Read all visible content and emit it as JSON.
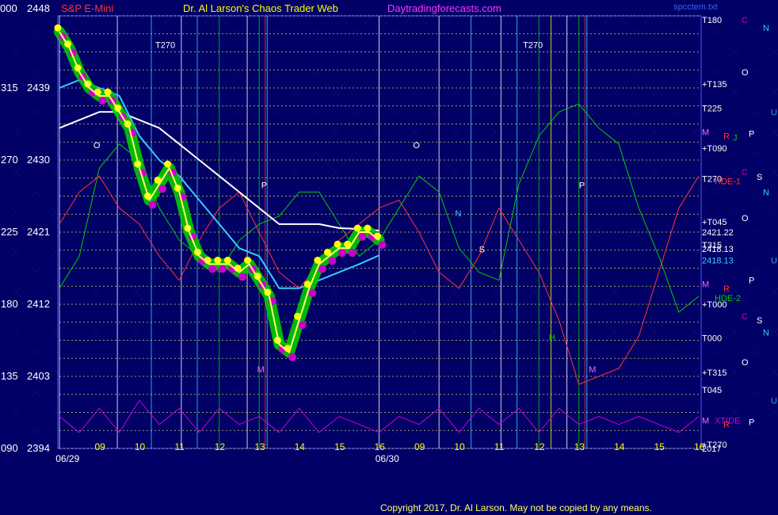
{
  "header": {
    "price_code": "000",
    "price_top": "2448",
    "instrument": "S&P E-Mini",
    "site_title": "Dr. Al Larson's Chaos Trader Web",
    "site_link": "Daytradingforecasts.com",
    "chart_file": "spcctem.txt"
  },
  "footer": {
    "copyright": "Copyright 2017, Dr. Al Larson. May not be copied by any means."
  },
  "colors": {
    "background": "#000066",
    "grid": "#5555ff",
    "yellow": "#ffff00",
    "white": "#ffffff",
    "cyan": "#33ccff",
    "green": "#00cc00",
    "magenta": "#cc00cc",
    "red": "#ff3333",
    "pink": "#ff66ff"
  },
  "chart_data": {
    "type": "line",
    "title": "S&P E-Mini",
    "ylim": [
      2394,
      2448
    ],
    "y_ticks": [
      {
        "code": "000",
        "price": "2448"
      },
      {
        "code": "315",
        "price": "2439"
      },
      {
        "code": "270",
        "price": "2430"
      },
      {
        "code": "225",
        "price": "2421"
      },
      {
        "code": "180",
        "price": "2412"
      },
      {
        "code": "135",
        "price": "2403"
      },
      {
        "code": "090",
        "price": "2394"
      }
    ],
    "x_hour_labels": [
      {
        "label": "09",
        "t": 1.0
      },
      {
        "label": "10",
        "t": 2.0
      },
      {
        "label": "11",
        "t": 3.0
      },
      {
        "label": "12",
        "t": 4.0
      },
      {
        "label": "13",
        "t": 5.0
      },
      {
        "label": "14",
        "t": 6.0
      },
      {
        "label": "15",
        "t": 7.0
      },
      {
        "label": "16",
        "t": 8.0
      },
      {
        "label": "09",
        "t": 9.0
      },
      {
        "label": "10",
        "t": 10.0
      },
      {
        "label": "11",
        "t": 11.0
      },
      {
        "label": "12",
        "t": 12.0
      },
      {
        "label": "13",
        "t": 13.0
      },
      {
        "label": "14",
        "t": 14.0
      },
      {
        "label": "15",
        "t": 15.0
      },
      {
        "label": "16",
        "t": 16.0
      }
    ],
    "x_date_labels": [
      {
        "label": "06/29",
        "t": 0.5
      },
      {
        "label": "06/30",
        "t": 8.5
      }
    ],
    "series": [
      {
        "name": "S&P E-Mini",
        "color": "#ffff00",
        "x": [
          0.0,
          0.25,
          0.5,
          0.75,
          1.0,
          1.25,
          1.5,
          1.75,
          2.0,
          2.25,
          2.5,
          2.75,
          3.0,
          3.25,
          3.5,
          3.75,
          4.0,
          4.25,
          4.5,
          4.75,
          5.0,
          5.25,
          5.5,
          5.75,
          6.0,
          6.25,
          6.5,
          6.75,
          7.0,
          7.25,
          7.5,
          7.75,
          8.0
        ],
        "values": [
          2446,
          2444,
          2441,
          2439,
          2438,
          2438,
          2436,
          2434,
          2429,
          2425,
          2427,
          2429,
          2426,
          2421,
          2418,
          2417,
          2417,
          2417,
          2416,
          2417,
          2415,
          2413,
          2407,
          2406,
          2410,
          2414,
          2417,
          2418,
          2419,
          2419,
          2421,
          2421,
          2420
        ]
      },
      {
        "name": "",
        "color": "#ffffff",
        "x": [
          0.0,
          0.5,
          1.0,
          1.5,
          2.0,
          2.5,
          3.0,
          3.5,
          4.0,
          4.5,
          5.0,
          5.5,
          6.0,
          6.5,
          7.0,
          7.5,
          8.0
        ],
        "values": [
          2434,
          2435,
          2436,
          2436,
          2435,
          2434,
          2432,
          2430,
          2428,
          2426,
          2424,
          2422,
          2422,
          2422,
          2421.5,
          2421.4,
          2421.2
        ]
      },
      {
        "name": "",
        "color": "#33ccff",
        "x": [
          0.0,
          0.5,
          1.0,
          1.5,
          2.0,
          2.5,
          3.0,
          3.5,
          4.0,
          4.5,
          5.0,
          5.5,
          6.0,
          6.5,
          7.0,
          7.5,
          8.0
        ],
        "values": [
          2439,
          2440,
          2439,
          2438,
          2433,
          2430,
          2428,
          2425,
          2422,
          2419,
          2418,
          2414,
          2414,
          2415,
          2416,
          2417,
          2418.1
        ]
      },
      {
        "name": "",
        "color": "#00cc00",
        "x": [
          0.0,
          0.5,
          1.0,
          1.5,
          2.0,
          2.5,
          3.0,
          3.5,
          4.0,
          4.5,
          5.0,
          5.5,
          6.0,
          6.5,
          7.0,
          7.5,
          8.0,
          8.5,
          9.0,
          9.5,
          10.0,
          10.5,
          11.0,
          11.5,
          12.0,
          12.5,
          13.0,
          13.5,
          14.0,
          14.5,
          15.0,
          15.5,
          16.0
        ],
        "values": [
          2414,
          2418,
          2429,
          2432,
          2430,
          2424,
          2420,
          2418,
          2416,
          2420,
          2422,
          2423,
          2426,
          2426,
          2422,
          2418,
          2420,
          2424,
          2428,
          2426,
          2419,
          2416,
          2415,
          2427,
          2433,
          2436,
          2437,
          2434,
          2432,
          2424,
          2418,
          2411,
          2413
        ]
      },
      {
        "name": "",
        "color": "#ff3333",
        "x": [
          0.0,
          0.5,
          1.0,
          1.5,
          2.0,
          2.5,
          3.0,
          3.5,
          4.0,
          4.5,
          5.0,
          5.5,
          6.0,
          6.5,
          7.0,
          7.5,
          8.0,
          8.5,
          9.0,
          9.5,
          10.0,
          10.5,
          11.0,
          11.5,
          12.0,
          12.5,
          13.0,
          13.5,
          14.0,
          14.5,
          15.0,
          15.5,
          16.0
        ],
        "values": [
          2422,
          2426,
          2428,
          2424,
          2422,
          2418,
          2415,
          2420,
          2424,
          2426,
          2421,
          2416,
          2414,
          2417,
          2420,
          2422,
          2424,
          2425,
          2421,
          2416,
          2414,
          2418,
          2424,
          2420,
          2416,
          2410,
          2402,
          2403,
          2404,
          2408,
          2416,
          2424,
          2428
        ]
      },
      {
        "name": "XTIDE",
        "color": "#cc00cc",
        "x": [
          0.0,
          0.5,
          1.0,
          1.5,
          2.0,
          2.5,
          3.0,
          3.5,
          4.0,
          4.5,
          5.0,
          5.5,
          6.0,
          6.5,
          7.0,
          7.5,
          8.0,
          8.5,
          9.0,
          9.5,
          10.0,
          10.5,
          11.0,
          11.5,
          12.0,
          12.5,
          13.0,
          13.5,
          14.0,
          14.5,
          15.0,
          15.5,
          16.0
        ],
        "values": [
          2398,
          2396,
          2399,
          2396,
          2400,
          2397,
          2399,
          2396,
          2399,
          2397,
          2398,
          2396,
          2399,
          2396,
          2398,
          2397,
          2396,
          2398,
          2397,
          2399,
          2396,
          2399,
          2397,
          2399,
          2396,
          2399,
          2397,
          2398,
          2397,
          2398,
          2397,
          2396,
          2398
        ]
      }
    ],
    "right_labels": [
      {
        "text": "T180",
        "price": 2447.5,
        "color": "#ffffff"
      },
      {
        "text": "+T135",
        "price": 2439.5,
        "color": "#ffffff"
      },
      {
        "text": "T225",
        "price": 2436.5,
        "color": "#ffffff"
      },
      {
        "text": "M",
        "price": 2433.5,
        "color": "#ff66ff"
      },
      {
        "text": "+T090",
        "price": 2431.5,
        "color": "#ffffff"
      },
      {
        "text": "T270",
        "price": 2427.7,
        "color": "#ffffff"
      },
      {
        "text": "HDE-1",
        "price": 2427.4,
        "color": "#ff3333"
      },
      {
        "text": "+T045",
        "price": 2422.3,
        "color": "#ffffff"
      },
      {
        "text": "2421.22",
        "price": 2421.0,
        "color": "#ffffff"
      },
      {
        "text": "T315",
        "price": 2419.4,
        "color": "#ffffff"
      },
      {
        "text": "2418.13",
        "price": 2418.9,
        "color": "#ffffff"
      },
      {
        "text": "2418.13",
        "price": 2417.5,
        "color": "#33ccff"
      },
      {
        "text": "M",
        "price": 2414.5,
        "color": "#ff66ff"
      },
      {
        "text": "HDE-2",
        "price": 2412.8,
        "color": "#00cc00"
      },
      {
        "text": "+T000",
        "price": 2412.0,
        "color": "#ffffff"
      },
      {
        "text": "T000",
        "price": 2407.8,
        "color": "#ffffff"
      },
      {
        "text": "+T315",
        "price": 2403.5,
        "color": "#ffffff"
      },
      {
        "text": "T045",
        "price": 2401.3,
        "color": "#ffffff"
      },
      {
        "text": "M",
        "price": 2397.5,
        "color": "#ff66ff"
      },
      {
        "text": "XTIDE",
        "price": 2397.5,
        "color": "#cc00cc"
      },
      {
        "text": "+T270",
        "price": 2394.5,
        "color": "#ffffff"
      },
      {
        "text": "2017",
        "price": 2394.0,
        "color": "#ffffff"
      }
    ],
    "planet_symbols": [
      {
        "text": "C",
        "price": 2447.5,
        "color": "#cc00cc"
      },
      {
        "text": "N",
        "price": 2446.5,
        "color": "#33ccff"
      },
      {
        "text": "O",
        "price": 2441.0,
        "color": "#ffffff"
      },
      {
        "text": "U",
        "price": 2436.0,
        "color": "#3399ff"
      },
      {
        "text": "R",
        "price": 2433.0,
        "color": "#ff3333"
      },
      {
        "text": "J",
        "price": 2432.8,
        "color": "#00cc00"
      },
      {
        "text": "P",
        "price": 2433.3,
        "color": "#ffffff"
      },
      {
        "text": "C",
        "price": 2428.5,
        "color": "#cc00cc"
      },
      {
        "text": "S",
        "price": 2427.9,
        "color": "#ffffff"
      },
      {
        "text": "N",
        "price": 2426.0,
        "color": "#33ccff"
      },
      {
        "text": "O",
        "price": 2422.8,
        "color": "#ffffff"
      },
      {
        "text": "U",
        "price": 2417.5,
        "color": "#3399ff"
      },
      {
        "text": "R",
        "price": 2414.0,
        "color": "#ff3333"
      },
      {
        "text": "P",
        "price": 2415.0,
        "color": "#ffffff"
      },
      {
        "text": "C",
        "price": 2410.5,
        "color": "#cc00cc"
      },
      {
        "text": "S",
        "price": 2410.0,
        "color": "#ffffff"
      },
      {
        "text": "N",
        "price": 2408.5,
        "color": "#33ccff"
      },
      {
        "text": "O",
        "price": 2404.8,
        "color": "#ffffff"
      },
      {
        "text": "U",
        "price": 2400.0,
        "color": "#3399ff"
      },
      {
        "text": "R",
        "price": 2397.0,
        "color": "#ff3333"
      },
      {
        "text": "P",
        "price": 2397.3,
        "color": "#ffffff"
      }
    ],
    "chart_markers": [
      {
        "text": "T270",
        "t": 2.4,
        "price": 2444.0,
        "color": "#ffffff"
      },
      {
        "text": "T270",
        "t": 11.6,
        "price": 2444.0,
        "color": "#ffffff"
      },
      {
        "text": "O",
        "t": 0.85,
        "price": 2431.5,
        "color": "#ffffff"
      },
      {
        "text": "O",
        "t": 8.85,
        "price": 2431.5,
        "color": "#ffffff"
      },
      {
        "text": "P",
        "t": 5.05,
        "price": 2426.5,
        "color": "#ffffff"
      },
      {
        "text": "P",
        "t": 13.0,
        "price": 2426.5,
        "color": "#ffffff"
      },
      {
        "text": "N",
        "t": 9.9,
        "price": 2423.0,
        "color": "#33ccff"
      },
      {
        "text": "S",
        "t": 10.5,
        "price": 2418.5,
        "color": "#ffffff"
      },
      {
        "text": "H",
        "t": 12.25,
        "price": 2407.5,
        "color": "#00cc00"
      },
      {
        "text": "M",
        "t": 13.25,
        "price": 2403.5,
        "color": "#ff66ff"
      },
      {
        "text": "M",
        "t": 4.95,
        "price": 2403.5,
        "color": "#ff66ff"
      }
    ],
    "vertical_lines": [
      {
        "t": 0.0,
        "color": "#ffffff"
      },
      {
        "t": 1.45,
        "color": "#ffffff"
      },
      {
        "t": 2.3,
        "color": "#33ccff"
      },
      {
        "t": 3.05,
        "color": "#ffffff"
      },
      {
        "t": 3.45,
        "color": "#33ccff"
      },
      {
        "t": 4.0,
        "color": "#00cc00"
      },
      {
        "t": 4.7,
        "color": "#ffffff"
      },
      {
        "t": 5.0,
        "color": "#00cc00"
      },
      {
        "t": 5.15,
        "color": "#ff3333"
      },
      {
        "t": 5.2,
        "color": "#33ccff"
      },
      {
        "t": 8.0,
        "color": "#ffffff"
      },
      {
        "t": 9.5,
        "color": "#ffffff"
      },
      {
        "t": 10.3,
        "color": "#33ccff"
      },
      {
        "t": 11.05,
        "color": "#ffffff"
      },
      {
        "t": 11.45,
        "color": "#33ccff"
      },
      {
        "t": 12.0,
        "color": "#00cc00"
      },
      {
        "t": 12.3,
        "color": "#ffff00"
      },
      {
        "t": 12.7,
        "color": "#ffffff"
      },
      {
        "t": 13.0,
        "color": "#00cc00"
      },
      {
        "t": 13.15,
        "color": "#ff3333"
      },
      {
        "t": 13.2,
        "color": "#33ccff"
      }
    ]
  }
}
